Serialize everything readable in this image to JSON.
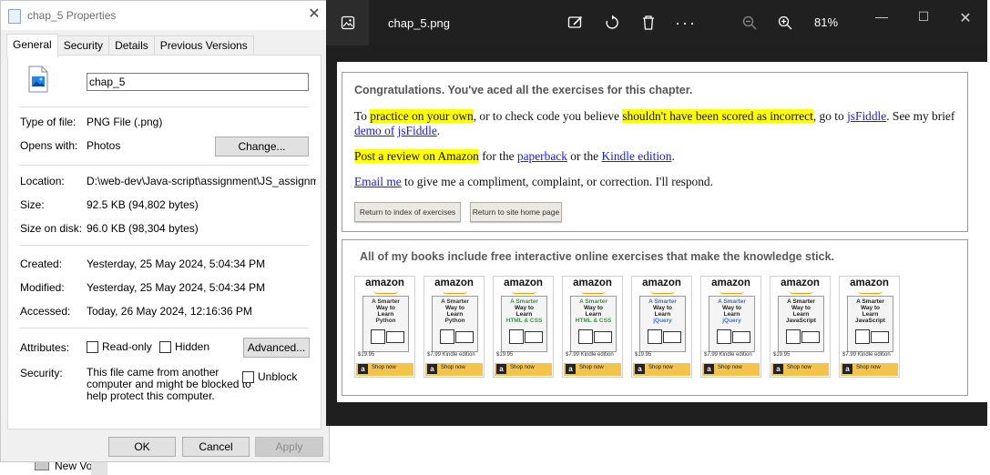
{
  "desktop": {
    "drive_label": "New Vol"
  },
  "properties": {
    "title": "chap_5 Properties",
    "tabs": [
      "General",
      "Security",
      "Details",
      "Previous Versions"
    ],
    "file_name": "chap_5",
    "type_label": "Type of file:",
    "type_value": "PNG File (.png)",
    "opens_label": "Opens with:",
    "opens_value": "Photos",
    "change_button": "Change...",
    "location_label": "Location:",
    "location_value": "D:\\web-dev\\Java-script\\assignment\\JS_assignment",
    "size_label": "Size:",
    "size_value": "92.5 KB (94,802 bytes)",
    "size_disk_label": "Size on disk:",
    "size_disk_value": "96.0 KB (98,304 bytes)",
    "created_label": "Created:",
    "created_value": "Yesterday, 25 May 2024, 5:04:34 PM",
    "modified_label": "Modified:",
    "modified_value": "Yesterday, 25 May 2024, 5:04:34 PM",
    "accessed_label": "Accessed:",
    "accessed_value": "Today, 26 May 2024, 12:16:36 PM",
    "attributes_label": "Attributes:",
    "readonly_label": "Read-only",
    "hidden_label": "Hidden",
    "advanced_button": "Advanced...",
    "security_label": "Security:",
    "security_lines": [
      "This file came from another",
      "computer and might be blocked to",
      "help protect this computer."
    ],
    "unblock_label": "Unblock",
    "ok_button": "OK",
    "cancel_button": "Cancel",
    "apply_button": "Apply"
  },
  "photos": {
    "file_name": "chap_5.png",
    "zoom": "81%",
    "page": {
      "congrats": "Congratulations. You've aced all the exercises for this chapter.",
      "p1": {
        "a": "To ",
        "hl1": "practice on your own",
        "b": ", or to check code you believe ",
        "hl2": "shouldn't have been scored as incorrect",
        "c": ", go to ",
        "link1": "jsFiddle",
        "d": ". See my brief ",
        "link2": "demo of",
        "e": " ",
        "link3": "jsFiddle",
        "f": "."
      },
      "p2": {
        "hl": "Post a review on Amazon",
        "a": " for the ",
        "link1": "paperback",
        "b": " or the ",
        "link2": "Kindle edition",
        "c": "."
      },
      "p3": {
        "link": "Email me",
        "a": " to give me a compliment, complaint, or correction. I'll respond."
      },
      "btn1": "Return to index of exercises",
      "btn2": "Return to site home page",
      "books_title": "All of my books include free interactive online exercises that make the knowledge stick.",
      "books": [
        {
          "brand": "amazon",
          "lines": [
            "A Smarter",
            "Way to",
            "Learn",
            "Python"
          ],
          "color": "#333333",
          "price": "$19.95",
          "shop": "Shop now"
        },
        {
          "brand": "amazon",
          "lines": [
            "A Smarter",
            "Way to",
            "Learn",
            "Python"
          ],
          "color": "#333333",
          "price": "$7.99 Kindle edition",
          "shop": "Shop now"
        },
        {
          "brand": "amazon",
          "lines": [
            "A Smarter",
            "Way to",
            "Learn",
            "HTML & CSS"
          ],
          "color": "#2e9a3e",
          "price": "$19.95",
          "shop": "Shop now"
        },
        {
          "brand": "amazon",
          "lines": [
            "A Smarter",
            "Way to",
            "Learn",
            "HTML & CSS"
          ],
          "color": "#2e9a3e",
          "price": "$7.99 Kindle edition",
          "shop": "Shop now"
        },
        {
          "brand": "amazon",
          "lines": [
            "A Smarter",
            "Way to",
            "Learn",
            "jQuery"
          ],
          "color": "#3a6fd8",
          "price": "$19.95",
          "shop": "Shop now"
        },
        {
          "brand": "amazon",
          "lines": [
            "A Smarter",
            "Way to",
            "Learn",
            "jQuery"
          ],
          "color": "#3a6fd8",
          "price": "$7.99 Kindle edition",
          "shop": "Shop now"
        },
        {
          "brand": "amazon",
          "lines": [
            "A Smarter",
            "Way to",
            "Learn",
            "JavaScript"
          ],
          "color": "#222222",
          "price": "$19.95",
          "shop": "Shop now"
        },
        {
          "brand": "amazon",
          "lines": [
            "A Smarter",
            "Way to",
            "Learn",
            "JavaScript"
          ],
          "color": "#222222",
          "price": "$7.99 Kindle edition",
          "shop": "Shop now"
        }
      ]
    }
  }
}
